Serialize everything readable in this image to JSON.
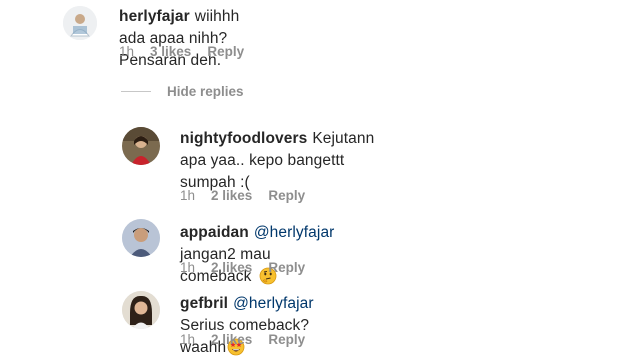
{
  "comments": [
    {
      "username": "herlyfajar",
      "text": "wiihhh ada apaa nihh? Pensaran deh.",
      "time": "1h",
      "likes": "3 likes",
      "reply": "Reply"
    }
  ],
  "hide_replies_label": "Hide replies",
  "replies": [
    {
      "username": "nightyfoodlovers",
      "text_line1": "Kejutann apa yaa.. kepo bangettt",
      "text_line2": "sumpah :(",
      "time": "1h",
      "likes": "2 likes",
      "reply": "Reply"
    },
    {
      "username": "appaidan",
      "mention": "@herlyfajar",
      "text": "jangan2 mau comeback",
      "emoji": "thinking-face-icon",
      "time": "1h",
      "likes": "2 likes",
      "reply": "Reply"
    },
    {
      "username": "gefbril",
      "mention": "@herlyfajar",
      "text": "Serius comeback? waahh",
      "emoji": "star-struck-face-icon",
      "time": "1h",
      "likes": "2 likes",
      "reply": "Reply"
    }
  ],
  "colors": {
    "text": "#262626",
    "meta": "#8e8e8e",
    "mention": "#00376b",
    "emoji_yellow": "#f7c02f"
  }
}
